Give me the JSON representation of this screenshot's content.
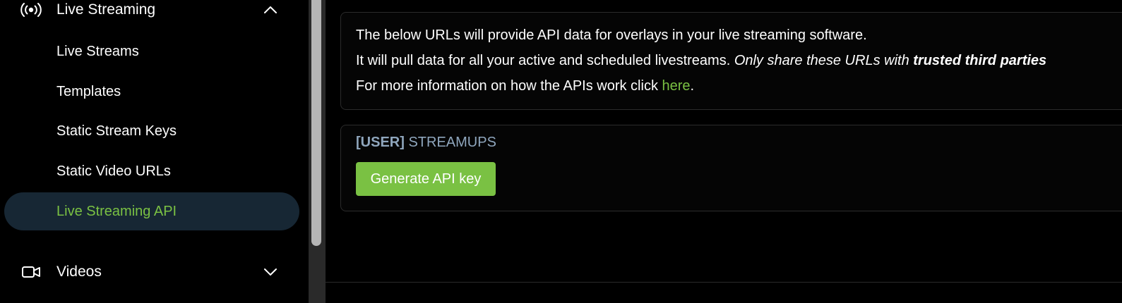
{
  "sidebar": {
    "group_live": {
      "label": "Live Streaming",
      "icon": "broadcast-icon",
      "expanded": true
    },
    "items": [
      {
        "label": "Live Streams",
        "active": false
      },
      {
        "label": "Templates",
        "active": false
      },
      {
        "label": "Static Stream Keys",
        "active": false
      },
      {
        "label": "Static Video URLs",
        "active": false
      },
      {
        "label": "Live Streaming API",
        "active": true
      }
    ],
    "group_videos": {
      "label": "Videos",
      "icon": "video-camera-icon",
      "expanded": false
    }
  },
  "main": {
    "info": {
      "line1": "The below URLs will provide API data for overlays in your live streaming software.",
      "line2_prefix": "It will pull data for all your active and scheduled livestreams. ",
      "line2_italic": "Only share these URLs with ",
      "line2_bold": "trusted third parties",
      "line3_prefix": "For more information on how the APIs work click ",
      "line3_link": "here",
      "line3_suffix": "."
    },
    "api_key": {
      "tag": "[USER]",
      "name": " STREAMUPS",
      "button": "Generate API key"
    }
  },
  "colors": {
    "accent": "#7ac143",
    "active_bg": "#172734",
    "key_title": "#8fa6bd"
  }
}
